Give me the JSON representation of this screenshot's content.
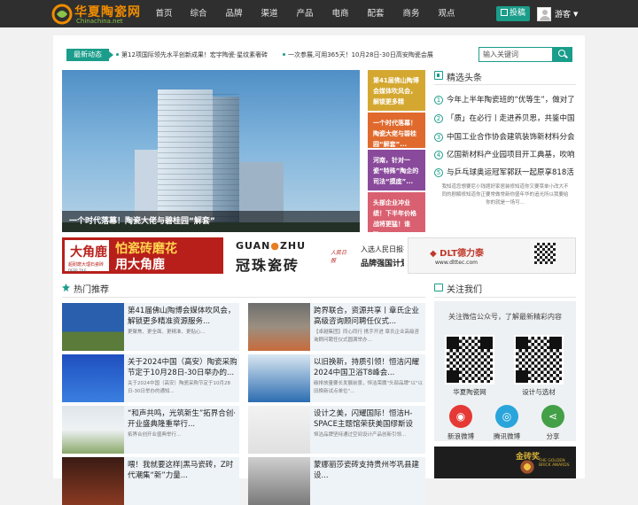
{
  "header": {
    "logo_text": "华夏陶瓷网",
    "logo_sub": "Chinachina.net",
    "nav": [
      "首页",
      "综合",
      "品牌",
      "渠道",
      "产品",
      "电商",
      "配套",
      "商务",
      "观点"
    ],
    "post_label": "投稿",
    "user_name": "游客",
    "accent": "#1a9d8a",
    "logo_color": "#f08c00"
  },
  "ticker": {
    "label": "最新动态",
    "items": [
      "第12项国际领先水平创新成果！宏宇陶瓷·星纹素奢砖",
      "一次参展,可用365天！10月28日-30日高安陶瓷会展"
    ]
  },
  "search": {
    "placeholder": "输入关键词"
  },
  "banner": {
    "caption": "一个时代落幕！陶瓷大佬与碧桂园“解套”"
  },
  "tiles": [
    "第41届佛山陶博会媒体吹风会，解锁更多精",
    "一个时代落幕！陶瓷大佬与碧桂园“解套”...",
    "河南，针对一瓷“特殊”陶企的司法“摸底”...",
    "头部企业冲业绩！下半年价格战将更猛！谁碎..."
  ],
  "headlines": {
    "title": "精选头条",
    "items": [
      "今年上半年陶瓷班的“优等生”，做对了",
      "「质」在必行丨走进养贝思，共鉴中国",
      "中国工业合作协会建筑装饰新材料分会",
      "亿国新材料产业园项目开工典基，吹响",
      "与乒乓球奥运冠军郭跃一起原享818活"
    ],
    "blurb": "我知道您想要尼小钱题好家居装修知道你又要菜单小改大不同的剧解修知道你正要常做常新你盛年华的追光所以我要给你的就是一场可..."
  },
  "ads": {
    "ad1_brand": "大角鹿",
    "ad1_sub": "超耐磨大理石瓷砖",
    "ad1_en": "DEER TILE",
    "ad1_slogan1": "怕瓷砖磨花",
    "ad1_slogan2": "用大角鹿",
    "ad2_en_a": "GUAN",
    "ad2_en_o": "●",
    "ad2_en_b": "ZHU",
    "ad2_cn": "冠珠瓷砖",
    "ad2_seal": "人民日报",
    "ad2_t1": "入选人民日报社",
    "ad2_t2": "品牌强国计划",
    "ad3_logo": "◆ DLT德力泰",
    "ad3_url": "www.dlttec.com"
  },
  "hot": {
    "title": "热门推荐",
    "cards": [
      {
        "title": "第41届佛山陶博会媒体吹风会，解锁更多精准资源服务...",
        "desc": "更聚焦、更全面、更精准、更贴心..."
      },
      {
        "title": "跨界联合，资源共享丨章氏企业高级咨询顾问聘任仪式...",
        "desc": "【卓越集团】同心同行 携手开进 章氏企业高级咨询顾问聘任仪式圆满举办..."
      },
      {
        "title": "关于2024中国（高安）陶瓷采购节定于10月28日-30日举办的...",
        "desc": "关于2024中国（高安）陶瓷采购节定于10月28日-30日举办的通知..."
      },
      {
        "title": "以旧换新，持质引领！恒洁闪耀2024中国卫浴T8峰会...",
        "desc": "碳排放量要长发展前景，恒洁荣膺\"头部品牌\"以\"以旧换新试点单位\"..."
      },
      {
        "title": "“和声共鸣，光筑新生”拓界合创·开业盛典隆重举行...",
        "desc": "拓界合创开业盛典举行..."
      },
      {
        "title": "设计之美，闪耀国际！恒洁H-SPACE主题馆荣获美国缪斯设计...",
        "desc": "恒洁品牌坚持通过空间设计产品创新引领..."
      },
      {
        "title": "喂！我就要这样|黑马瓷砖，Z时代潮集“新”力量...",
        "desc": ""
      },
      {
        "title": "蒙娜丽莎瓷砖支持贵州岑巩县建设...",
        "desc": ""
      }
    ]
  },
  "follow": {
    "title": "关注我们",
    "desc": "关注微信公众号，了解最新精彩内容",
    "qr1": "华夏陶瓷网",
    "qr2": "设计与选材",
    "social": [
      "新浪微博",
      "腾讯微博",
      "分享"
    ]
  },
  "bottom_ad": {
    "cn": "金砖奖",
    "en1": "THE GOLDEN",
    "en2": "BRICK AWARDS"
  }
}
